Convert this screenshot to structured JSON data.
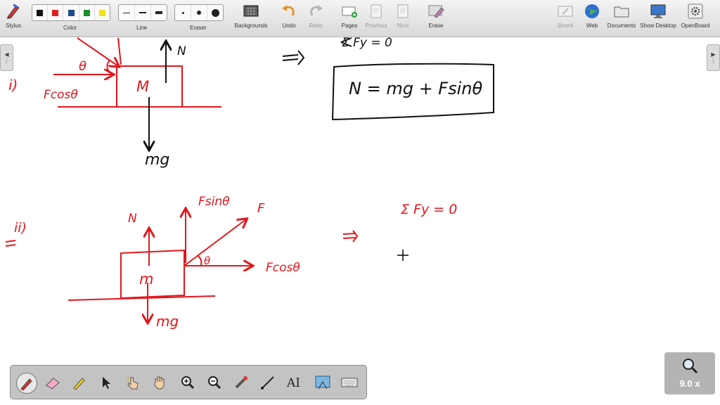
{
  "toolbar": {
    "stylus": "Stylus",
    "color": "Color",
    "line": "Line",
    "eraser": "Eraser",
    "backgrounds": "Backgrounds",
    "undo": "Undo",
    "redo": "Redo",
    "pages": "Pages",
    "previous": "Previous",
    "next": "Next",
    "erase": "Erase",
    "board": "Board",
    "web": "Web",
    "documents": "Documents",
    "show_desktop": "Show Desktop",
    "openboard": "OpenBoard"
  },
  "colors": {
    "black": "#111111",
    "red": "#e02020",
    "blue": "#1d4e8c",
    "green": "#1a8f2a",
    "yellow": "#f2e21b",
    "ink": "#e3161c",
    "pen": "#111111"
  },
  "zoom": {
    "label": "9.0 x"
  },
  "board": {
    "part1": {
      "label": "i)",
      "theta": "θ",
      "fcos": "Fcosθ",
      "mass": "M",
      "normal": "N",
      "weight": "mg",
      "implies": "⇒",
      "sum_fy": "Σ Fy = 0",
      "result": "N = mg + Fsinθ"
    },
    "part2": {
      "label": "ii)",
      "fsin": "Fsinθ",
      "force": "F",
      "normal": "N",
      "mass": "m",
      "theta": "θ",
      "fcos": "Fcosθ",
      "weight": "mg",
      "implies": "⇒",
      "sum_fy": "Σ Fy = 0",
      "plus": "+"
    }
  }
}
